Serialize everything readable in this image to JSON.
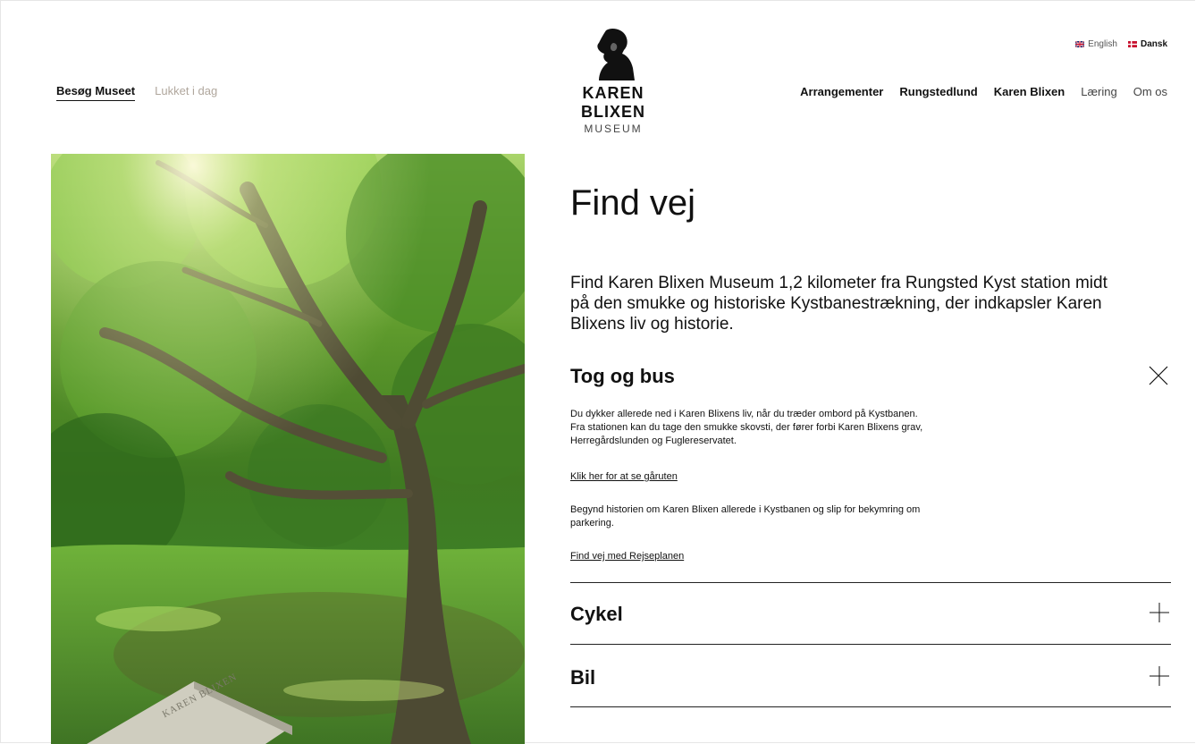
{
  "header": {
    "visit_label": "Besøg Museet",
    "status_label": "Lukket i dag",
    "logo_name": "KAREN BLIXEN",
    "logo_sub": "MUSEUM",
    "languages": [
      {
        "label": "English",
        "active": false
      },
      {
        "label": "Dansk",
        "active": true
      }
    ],
    "nav": [
      "Arrangementer",
      "Rungstedlund",
      "Karen Blixen",
      "Læring",
      "Om os"
    ]
  },
  "main": {
    "title": "Find vej",
    "lead": "Find Karen Blixen Museum 1,2 kilometer fra Rungsted Kyst station midt på den smukke og historiske Kystbanestrækning, der indkapsler Karen Blixens liv og historie.",
    "accordion": [
      {
        "title": "Tog og bus",
        "open": true,
        "paragraph1": "Du dykker allerede ned i Karen Blixens liv, når du træder ombord på Kystbanen. Fra stationen kan du tage den smukke skovsti, der fører forbi Karen Blixens grav, Herregårdslunden og Fuglereservatet.",
        "link1": "Klik her for at se gåruten",
        "paragraph2": "Begynd historien om Karen Blixen allerede i Kystbanen og slip for bekymring om parkering.",
        "link2": "Find vej med Rejseplanen"
      },
      {
        "title": "Cykel",
        "open": false
      },
      {
        "title": "Bil",
        "open": false
      }
    ]
  },
  "photo": {
    "stone_text": "KAREN BLIXEN"
  },
  "colors": {
    "text": "#111111",
    "muted": "#b0a79d",
    "danish_red": "#c8102e"
  },
  "icons": [
    "close-icon",
    "plus-icon",
    "logo-silhouette-icon",
    "flag-uk-icon",
    "flag-dk-icon"
  ]
}
